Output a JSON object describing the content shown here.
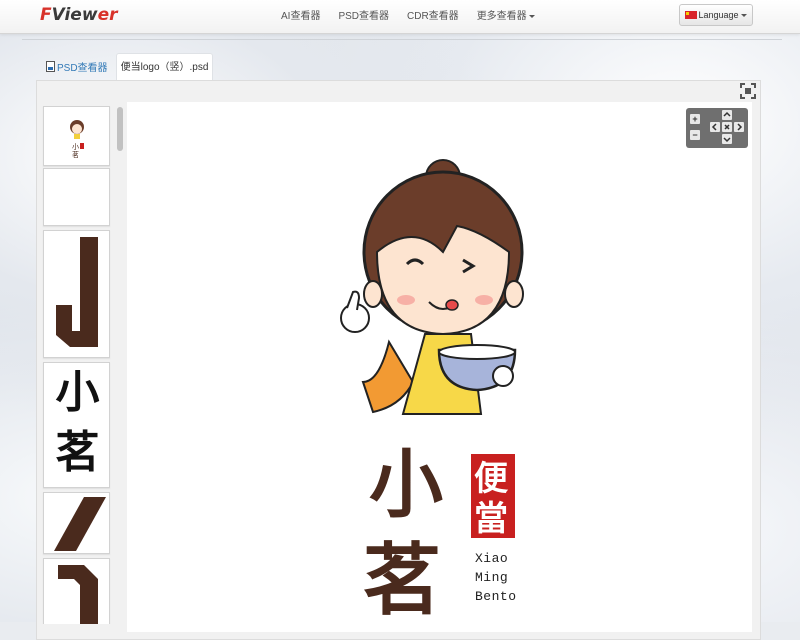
{
  "brand": {
    "logo_f": "F",
    "logo_rest": "Vie",
    "logo_w": "w",
    "logo_er": "er"
  },
  "nav": {
    "items": [
      {
        "label": "AI查看器"
      },
      {
        "label": "PSD查看器"
      },
      {
        "label": "CDR查看器"
      },
      {
        "label": "更多查看器"
      }
    ],
    "language_label": "Language"
  },
  "tabs": [
    {
      "label": "PSD查看器"
    },
    {
      "label": "便当logo（竖）.psd"
    }
  ],
  "thumbnails": [
    {
      "glyph": ""
    },
    {
      "glyph": ""
    },
    {
      "glyph": "J"
    },
    {
      "glyph": "小"
    },
    {
      "glyph": "茗"
    },
    {
      "glyph": ""
    },
    {
      "glyph": ""
    }
  ],
  "logo_art": {
    "main_chars": [
      "小",
      "茗"
    ],
    "badge_chars": [
      "便",
      "當"
    ],
    "latin_lines": [
      "Xiao",
      "Ming",
      "Bento"
    ]
  },
  "zoom_controls": {
    "plus": "+",
    "minus": "−"
  },
  "colors": {
    "brand_red": "#d8322a",
    "logo_brown": "#4a2a1d",
    "badge_red": "#c8201f"
  }
}
